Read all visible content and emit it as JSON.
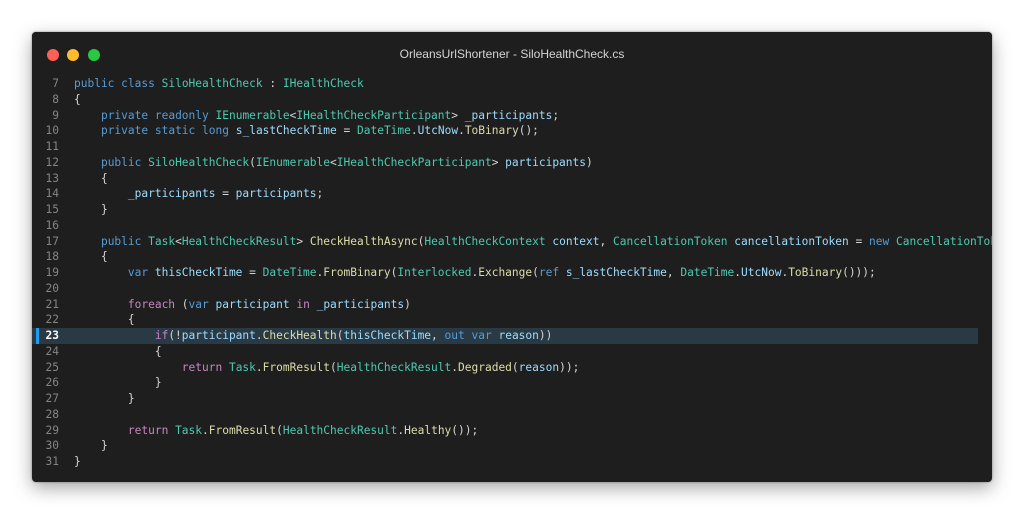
{
  "window": {
    "title": "OrleansUrlShortener - SiloHealthCheck.cs"
  },
  "colors": {
    "keyword": "#569cd6",
    "control": "#c586c0",
    "type": "#4ec9b0",
    "function": "#dcdcaa",
    "variable": "#9cdcfe",
    "plain": "#d4d4d4",
    "line_number": "#858585",
    "current_line_bg": "#2a3a45",
    "current_line_marker": "#1f9cf0"
  },
  "editor": {
    "current_line": 23,
    "lines": [
      {
        "n": "7",
        "tokens": [
          [
            "kw",
            "public"
          ],
          [
            "pl",
            " "
          ],
          [
            "kw",
            "class"
          ],
          [
            "pl",
            " "
          ],
          [
            "ty",
            "SiloHealthCheck"
          ],
          [
            "pl",
            " : "
          ],
          [
            "ty",
            "IHealthCheck"
          ]
        ]
      },
      {
        "n": "8",
        "tokens": [
          [
            "pl",
            "{"
          ]
        ]
      },
      {
        "n": "9",
        "tokens": [
          [
            "pl",
            "    "
          ],
          [
            "kw",
            "private"
          ],
          [
            "pl",
            " "
          ],
          [
            "kw",
            "readonly"
          ],
          [
            "pl",
            " "
          ],
          [
            "ty",
            "IEnumerable"
          ],
          [
            "pl",
            "<"
          ],
          [
            "ty",
            "IHealthCheckParticipant"
          ],
          [
            "pl",
            "> "
          ],
          [
            "vr",
            "_participants"
          ],
          [
            "pl",
            ";"
          ]
        ]
      },
      {
        "n": "10",
        "tokens": [
          [
            "pl",
            "    "
          ],
          [
            "kw",
            "private"
          ],
          [
            "pl",
            " "
          ],
          [
            "kw",
            "static"
          ],
          [
            "pl",
            " "
          ],
          [
            "kw",
            "long"
          ],
          [
            "pl",
            " "
          ],
          [
            "vr",
            "s_lastCheckTime"
          ],
          [
            "pl",
            " = "
          ],
          [
            "ty",
            "DateTime"
          ],
          [
            "pl",
            "."
          ],
          [
            "vr",
            "UtcNow"
          ],
          [
            "pl",
            "."
          ],
          [
            "fn",
            "ToBinary"
          ],
          [
            "pl",
            "();"
          ]
        ]
      },
      {
        "n": "11",
        "tokens": []
      },
      {
        "n": "12",
        "tokens": [
          [
            "pl",
            "    "
          ],
          [
            "kw",
            "public"
          ],
          [
            "pl",
            " "
          ],
          [
            "ty",
            "SiloHealthCheck"
          ],
          [
            "pl",
            "("
          ],
          [
            "ty",
            "IEnumerable"
          ],
          [
            "pl",
            "<"
          ],
          [
            "ty",
            "IHealthCheckParticipant"
          ],
          [
            "pl",
            "> "
          ],
          [
            "vr",
            "participants"
          ],
          [
            "pl",
            ")"
          ]
        ]
      },
      {
        "n": "13",
        "tokens": [
          [
            "pl",
            "    {"
          ]
        ]
      },
      {
        "n": "14",
        "tokens": [
          [
            "pl",
            "        "
          ],
          [
            "vr",
            "_participants"
          ],
          [
            "pl",
            " = "
          ],
          [
            "vr",
            "participants"
          ],
          [
            "pl",
            ";"
          ]
        ]
      },
      {
        "n": "15",
        "tokens": [
          [
            "pl",
            "    }"
          ]
        ]
      },
      {
        "n": "16",
        "tokens": []
      },
      {
        "n": "17",
        "tokens": [
          [
            "pl",
            "    "
          ],
          [
            "kw",
            "public"
          ],
          [
            "pl",
            " "
          ],
          [
            "ty",
            "Task"
          ],
          [
            "pl",
            "<"
          ],
          [
            "ty",
            "HealthCheckResult"
          ],
          [
            "pl",
            "> "
          ],
          [
            "fn",
            "CheckHealthAsync"
          ],
          [
            "pl",
            "("
          ],
          [
            "ty",
            "HealthCheckContext"
          ],
          [
            "pl",
            " "
          ],
          [
            "vr",
            "context"
          ],
          [
            "pl",
            ", "
          ],
          [
            "ty",
            "CancellationToken"
          ],
          [
            "pl",
            " "
          ],
          [
            "vr",
            "cancellationToken"
          ],
          [
            "pl",
            " = "
          ],
          [
            "kw",
            "new"
          ],
          [
            "pl",
            " "
          ],
          [
            "ty",
            "CancellationToken"
          ],
          [
            "pl",
            "())"
          ]
        ]
      },
      {
        "n": "18",
        "tokens": [
          [
            "pl",
            "    {"
          ]
        ]
      },
      {
        "n": "19",
        "tokens": [
          [
            "pl",
            "        "
          ],
          [
            "kw",
            "var"
          ],
          [
            "pl",
            " "
          ],
          [
            "vr",
            "thisCheckTime"
          ],
          [
            "pl",
            " = "
          ],
          [
            "ty",
            "DateTime"
          ],
          [
            "pl",
            "."
          ],
          [
            "fn",
            "FromBinary"
          ],
          [
            "pl",
            "("
          ],
          [
            "ty",
            "Interlocked"
          ],
          [
            "pl",
            "."
          ],
          [
            "fn",
            "Exchange"
          ],
          [
            "pl",
            "("
          ],
          [
            "kw",
            "ref"
          ],
          [
            "pl",
            " "
          ],
          [
            "vr",
            "s_lastCheckTime"
          ],
          [
            "pl",
            ", "
          ],
          [
            "ty",
            "DateTime"
          ],
          [
            "pl",
            "."
          ],
          [
            "vr",
            "UtcNow"
          ],
          [
            "pl",
            "."
          ],
          [
            "fn",
            "ToBinary"
          ],
          [
            "pl",
            "()));"
          ]
        ]
      },
      {
        "n": "20",
        "tokens": []
      },
      {
        "n": "21",
        "tokens": [
          [
            "pl",
            "        "
          ],
          [
            "kc",
            "foreach"
          ],
          [
            "pl",
            " ("
          ],
          [
            "kw",
            "var"
          ],
          [
            "pl",
            " "
          ],
          [
            "vr",
            "participant"
          ],
          [
            "pl",
            " "
          ],
          [
            "kc",
            "in"
          ],
          [
            "pl",
            " "
          ],
          [
            "vr",
            "_participants"
          ],
          [
            "pl",
            ")"
          ]
        ]
      },
      {
        "n": "22",
        "tokens": [
          [
            "pl",
            "        {"
          ]
        ]
      },
      {
        "n": "23",
        "tokens": [
          [
            "pl",
            "            "
          ],
          [
            "kc",
            "if"
          ],
          [
            "pl",
            "(!"
          ],
          [
            "vr",
            "participant"
          ],
          [
            "pl",
            "."
          ],
          [
            "fn",
            "CheckHealth"
          ],
          [
            "pl",
            "("
          ],
          [
            "vr",
            "thisCheckTime"
          ],
          [
            "pl",
            ", "
          ],
          [
            "kw",
            "out"
          ],
          [
            "pl",
            " "
          ],
          [
            "kw",
            "var"
          ],
          [
            "pl",
            " "
          ],
          [
            "vr",
            "reason"
          ],
          [
            "pl",
            "))"
          ]
        ]
      },
      {
        "n": "24",
        "tokens": [
          [
            "pl",
            "            {"
          ]
        ]
      },
      {
        "n": "25",
        "tokens": [
          [
            "pl",
            "                "
          ],
          [
            "kc",
            "return"
          ],
          [
            "pl",
            " "
          ],
          [
            "ty",
            "Task"
          ],
          [
            "pl",
            "."
          ],
          [
            "fn",
            "FromResult"
          ],
          [
            "pl",
            "("
          ],
          [
            "ty",
            "HealthCheckResult"
          ],
          [
            "pl",
            "."
          ],
          [
            "fn",
            "Degraded"
          ],
          [
            "pl",
            "("
          ],
          [
            "vr",
            "reason"
          ],
          [
            "pl",
            "));"
          ]
        ]
      },
      {
        "n": "26",
        "tokens": [
          [
            "pl",
            "            }"
          ]
        ]
      },
      {
        "n": "27",
        "tokens": [
          [
            "pl",
            "        }"
          ]
        ]
      },
      {
        "n": "28",
        "tokens": []
      },
      {
        "n": "29",
        "tokens": [
          [
            "pl",
            "        "
          ],
          [
            "kc",
            "return"
          ],
          [
            "pl",
            " "
          ],
          [
            "ty",
            "Task"
          ],
          [
            "pl",
            "."
          ],
          [
            "fn",
            "FromResult"
          ],
          [
            "pl",
            "("
          ],
          [
            "ty",
            "HealthCheckResult"
          ],
          [
            "pl",
            "."
          ],
          [
            "fn",
            "Healthy"
          ],
          [
            "pl",
            "());"
          ]
        ]
      },
      {
        "n": "30",
        "tokens": [
          [
            "pl",
            "    }"
          ]
        ]
      },
      {
        "n": "31",
        "tokens": [
          [
            "pl",
            "}"
          ]
        ]
      }
    ]
  }
}
